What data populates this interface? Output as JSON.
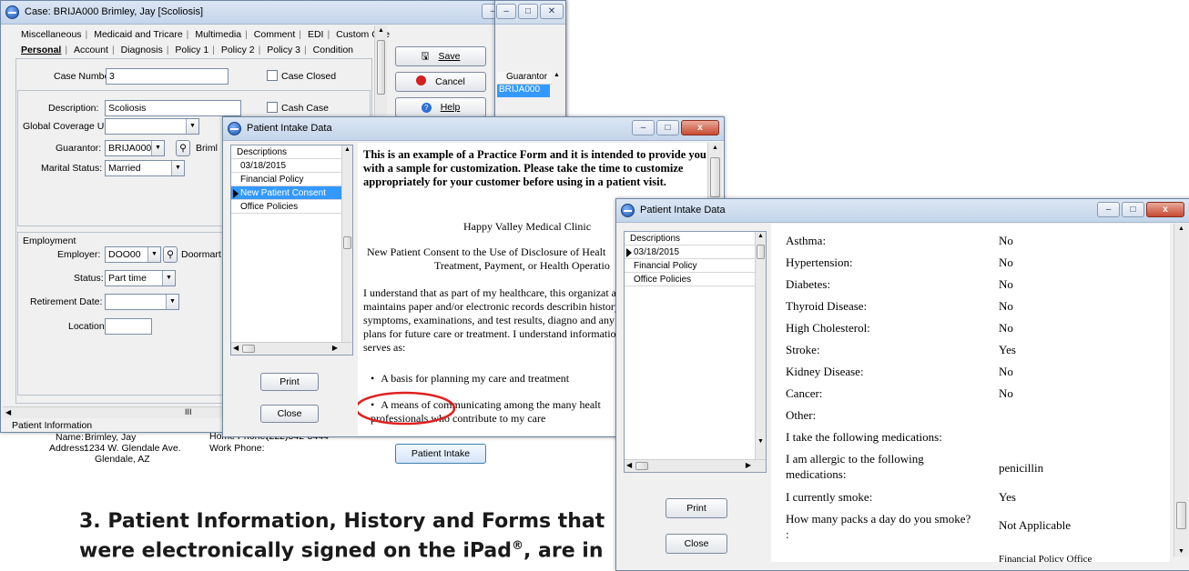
{
  "case_window": {
    "title": "Case: BRIJA000 Brimley, Jay  [Scoliosis]",
    "tabs_row1": [
      "Miscellaneous",
      "Medicaid and Tricare",
      "Multimedia",
      "Comment",
      "EDI",
      "Custom One"
    ],
    "tabs_row2": [
      "Personal",
      "Account",
      "Diagnosis",
      "Policy 1",
      "Policy 2",
      "Policy 3",
      "Condition"
    ],
    "case_number_label": "Case Number:",
    "case_number_value": "3",
    "case_closed_label": "Case Closed",
    "description_label": "Description:",
    "description_value": "Scoliosis",
    "cash_case_label": "Cash Case",
    "global_coverage_label": "Global Coverage Until:",
    "guarantor_label": "Guarantor:",
    "guarantor_value": "BRIJA000",
    "guarantor_name": "Briml",
    "marital_label": "Marital Status:",
    "marital_value": "Married",
    "employment_heading": "Employment",
    "employer_label": "Employer:",
    "employer_value": "DOO00",
    "employer_name": "Doormart",
    "status_label": "Status:",
    "status_value": "Part time",
    "retirement_label": "Retirement Date:",
    "location_label": "Location:",
    "patient_info_heading": "Patient Information",
    "name_label": "Name:",
    "name_value": "Brimley, Jay",
    "address_label": "Address:",
    "address_line1": "1234 W. Glendale Ave.",
    "address_line2": "Glendale, AZ",
    "home_phone_label": "Home Phone:",
    "home_phone_value": "(222)342-3444",
    "work_phone_label": "Work Phone:",
    "save_label": "Save",
    "cancel_label": "Cancel",
    "help_label": "Help",
    "patient_intake_label": "Patient Intake",
    "guarantor_col": "Guarantor",
    "guarantor_cell": "BRIJA000",
    "scroll_mark": "III"
  },
  "intake_1": {
    "title": "Patient Intake Data",
    "list_header": "Descriptions",
    "items": [
      "03/18/2015",
      "Financial Policy",
      "New Patient Consent",
      "Office Policies"
    ],
    "selected": "New Patient Consent",
    "print_label": "Print",
    "close_label": "Close",
    "intro": "This is an example of a Practice Form and it is intended to provide you with a sample for customization. Please take the time to customize appropriately for your customer before using in a patient visit.",
    "clinic": "Happy Valley Medical Clinic",
    "consent_line1": "New Patient Consent to the Use of Disclosure of Healt",
    "consent_line2": "Treatment, Payment, or Health Operatio",
    "body": "I understand that as part of my healthcare, this organizat and maintains paper and/or electronic records describin history, symptoms, examinations, and test results, diagno and any plans for future care or treatment. I understand information serves as:",
    "bullet1": "A basis for planning my care and treatment",
    "bullet2": "A means of communicating among the many healt professionals who contribute to my care"
  },
  "intake_2": {
    "title": "Patient Intake Data",
    "list_header": "Descriptions",
    "items": [
      "03/18/2015",
      "Financial Policy",
      "Office Policies"
    ],
    "print_label": "Print",
    "close_label": "Close",
    "history": [
      {
        "q": "Asthma:",
        "a": "No"
      },
      {
        "q": "Hypertension:",
        "a": "No"
      },
      {
        "q": "Diabetes:",
        "a": "No"
      },
      {
        "q": "Thyroid Disease:",
        "a": "No"
      },
      {
        "q": "High Cholesterol:",
        "a": "No"
      },
      {
        "q": "Stroke:",
        "a": "Yes"
      },
      {
        "q": "Kidney Disease:",
        "a": "No"
      },
      {
        "q": "Cancer:",
        "a": "No"
      },
      {
        "q": "Other:",
        "a": ""
      },
      {
        "q": "I take the following medications:",
        "a": ""
      }
    ],
    "allergic_q1": "I am allergic to the following",
    "allergic_q2": "medications:",
    "allergic_a": "penicillin",
    "smoke_q": "I currently smoke:",
    "smoke_a": "Yes",
    "packs_q": "How many packs a day do you smoke?",
    "packs_colon": ":",
    "packs_a": "Not Applicable",
    "cut_text": "Financial Policy Office"
  },
  "caption": {
    "line1": "3. Patient Information, History and Forms that",
    "line2": "were electronically signed on the iPad",
    "reg": "®",
    "line2_end": ", are in"
  },
  "colors": {
    "highlight": "#3399ff",
    "annotation_circle": "#e02020"
  }
}
